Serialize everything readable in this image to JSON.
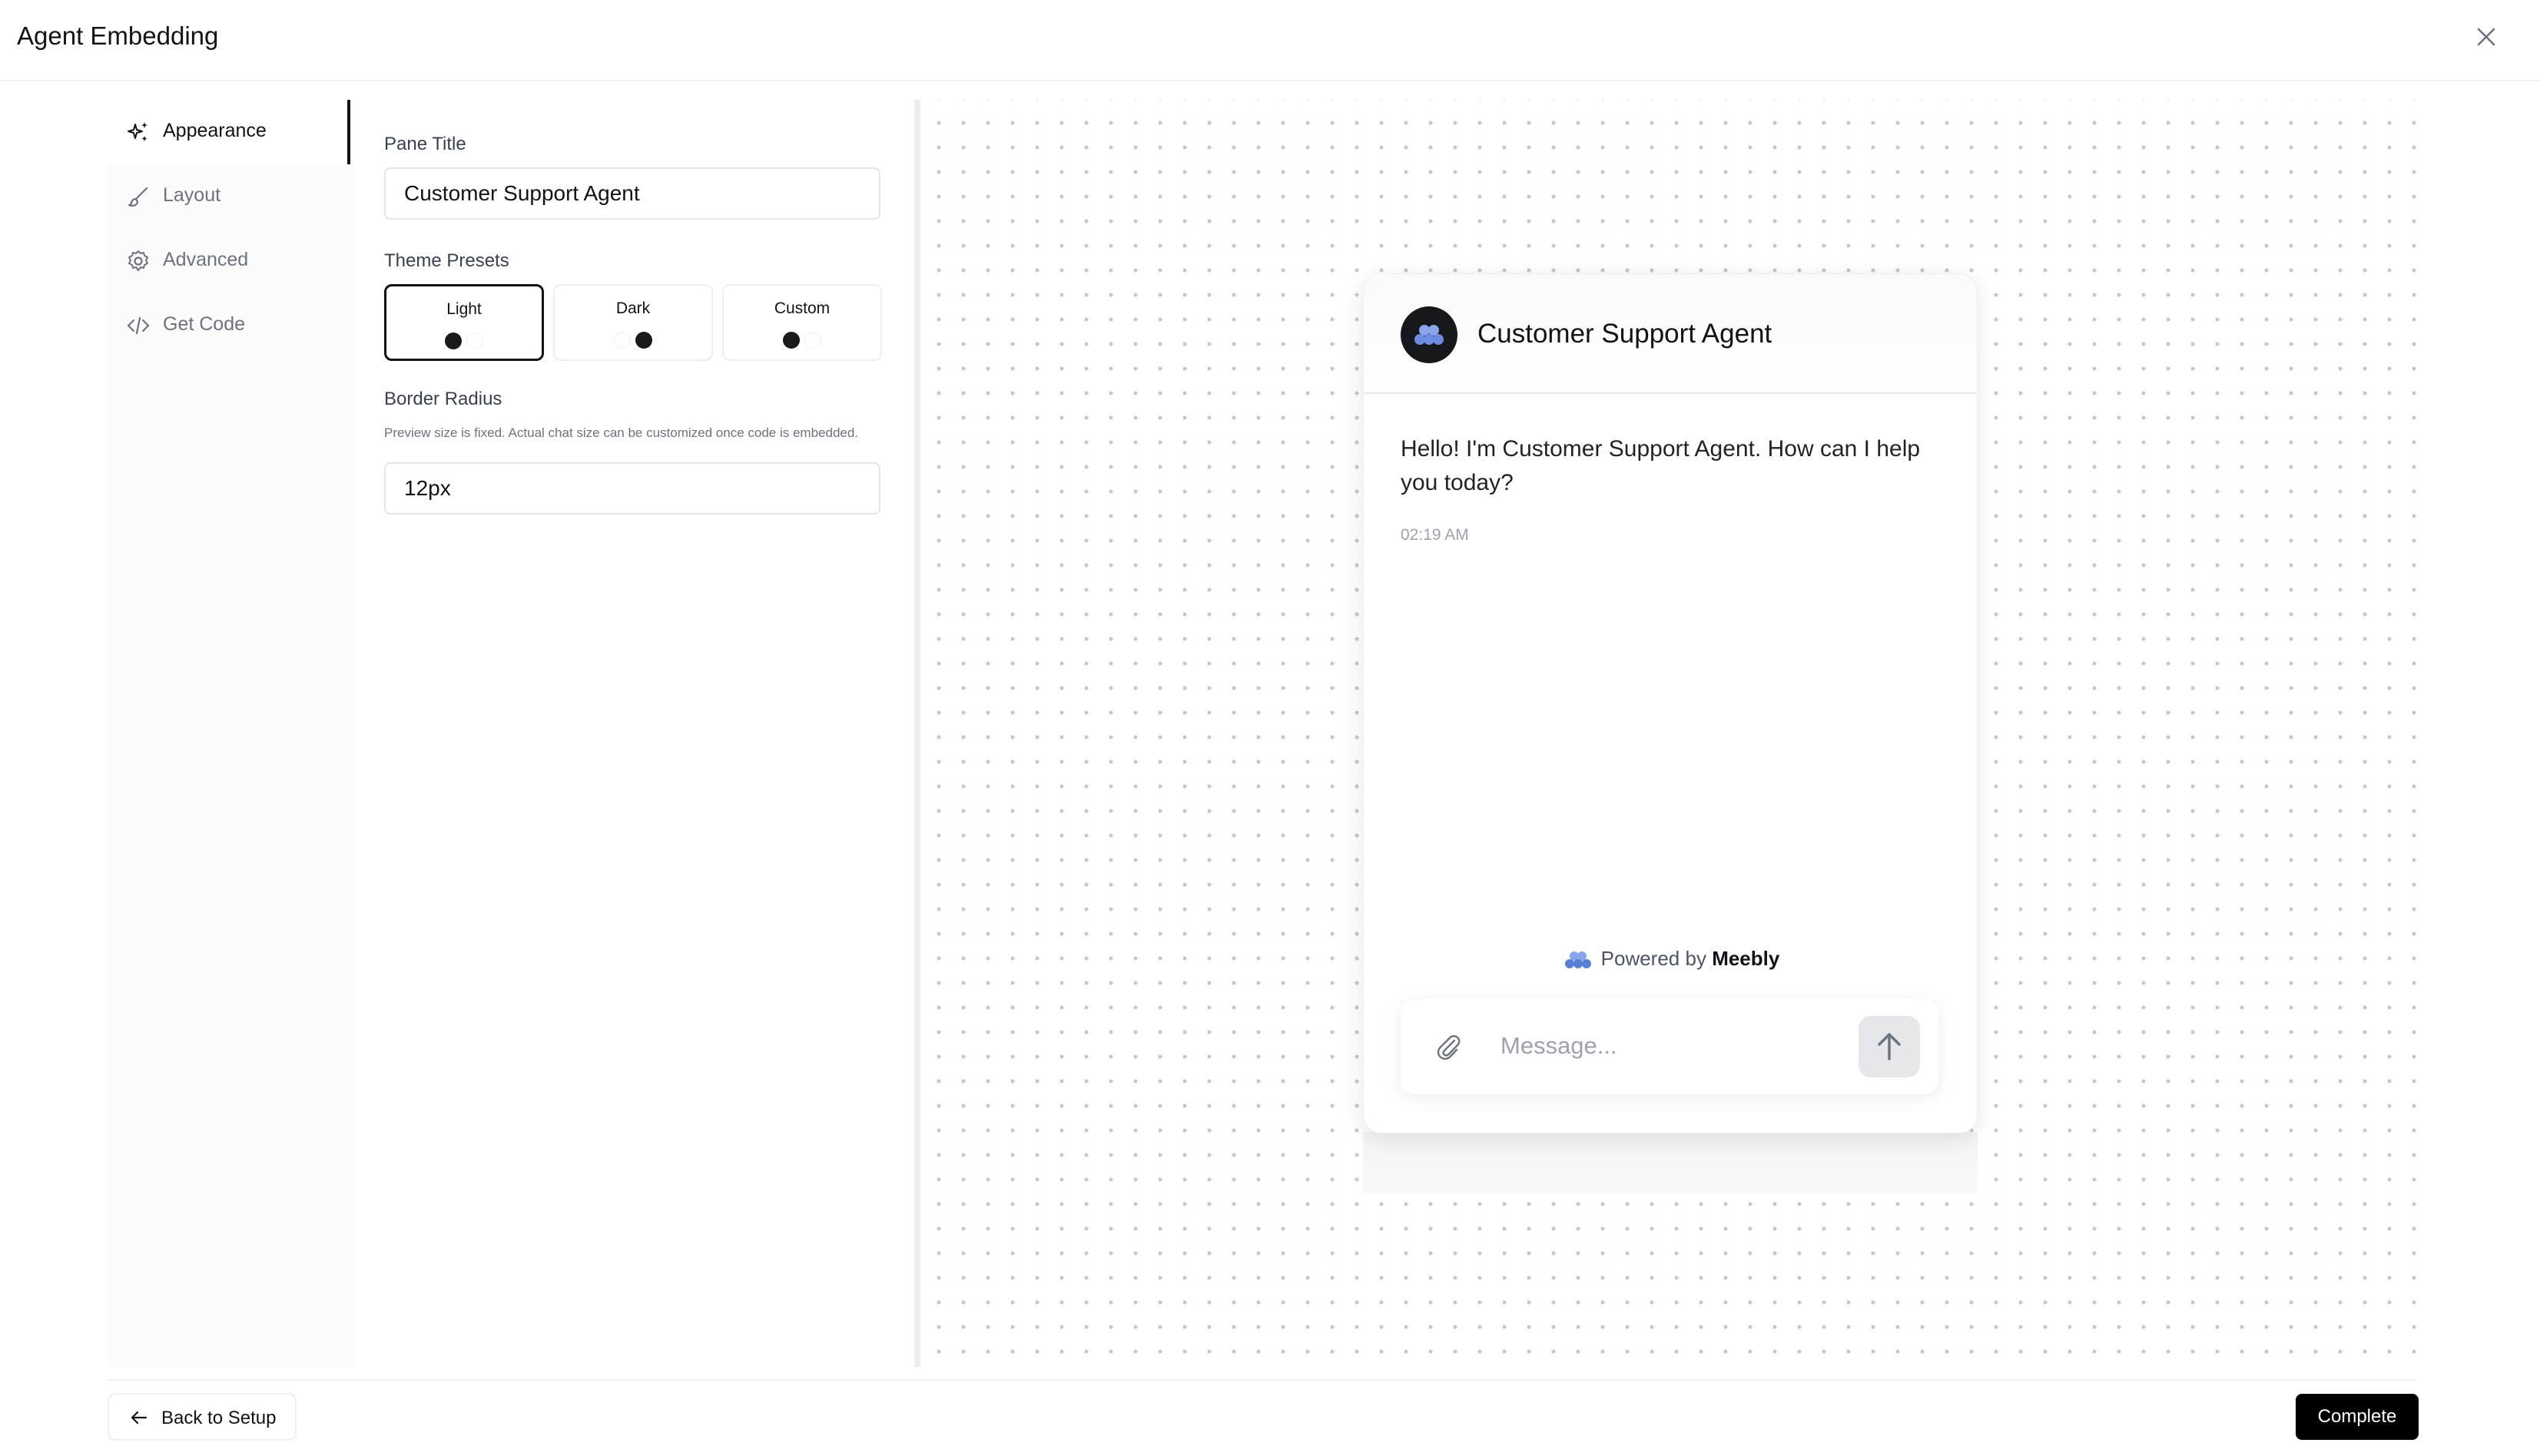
{
  "header": {
    "title": "Agent Embedding",
    "close_icon": "close-icon"
  },
  "sidebar": {
    "items": [
      {
        "label": "Appearance",
        "icon": "sparkles-icon",
        "active": true
      },
      {
        "label": "Layout",
        "icon": "brush-icon",
        "active": false
      },
      {
        "label": "Advanced",
        "icon": "gear-icon",
        "active": false
      },
      {
        "label": "Get Code",
        "icon": "code-icon",
        "active": false
      }
    ]
  },
  "form": {
    "pane_title_label": "Pane Title",
    "pane_title_value": "Customer Support Agent",
    "theme_presets_label": "Theme Presets",
    "presets": [
      {
        "label": "Light",
        "selected": true,
        "swatches": [
          "#1a1a1a",
          "#ffffff"
        ]
      },
      {
        "label": "Dark",
        "selected": false,
        "swatches": [
          "#ffffff",
          "#1a1a1a"
        ]
      },
      {
        "label": "Custom",
        "selected": false,
        "swatches": [
          "#1a1a1a",
          "#ffffff"
        ]
      }
    ],
    "border_radius_label": "Border Radius",
    "border_radius_hint": "Preview size is fixed. Actual chat size can be customized once code is embedded.",
    "border_radius_value": "12px"
  },
  "preview": {
    "chat_title": "Customer Support Agent",
    "message": "Hello! I'm Customer Support Agent. How can I help you today?",
    "message_time": "02:19 AM",
    "powered_prefix": "Powered by",
    "powered_brand": "Meebly",
    "composer_placeholder": "Message...",
    "brand_color": "#5b7fd6"
  },
  "footer": {
    "back_label": "Back to Setup",
    "complete_label": "Complete"
  }
}
